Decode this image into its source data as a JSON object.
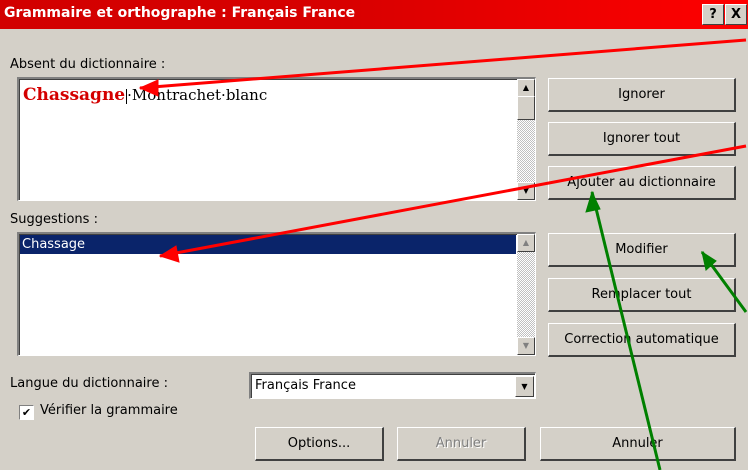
{
  "window": {
    "title": "Grammaire et orthographe : Français France",
    "help_label": "?",
    "close_label": "X"
  },
  "not_in_dictionary": {
    "label": "Absent du dictionnaire :",
    "error_word": "Chassagne",
    "rest_of_text": "·Montrachet·blanc"
  },
  "suggestions": {
    "label": "Suggestions :",
    "items": [
      "Chassage"
    ]
  },
  "buttons": {
    "ignore": "Ignorer",
    "ignore_all": "Ignorer tout",
    "add_to_dictionary": "Ajouter au dictionnaire",
    "change": "Modifier",
    "change_all": "Remplacer tout",
    "autocorrect": "Correction automatique",
    "options": "Options...",
    "undo": "Annuler",
    "cancel": "Annuler"
  },
  "language": {
    "label": "Langue du dictionnaire :",
    "value": "Français France"
  },
  "check_grammar": {
    "label": "Vérifier la grammaire",
    "checked": true
  },
  "colors": {
    "title_bar": "#d20000",
    "selection": "#0a246a",
    "error_text": "#d40000",
    "annotation_red": "#ff0000",
    "annotation_green": "#008000"
  }
}
